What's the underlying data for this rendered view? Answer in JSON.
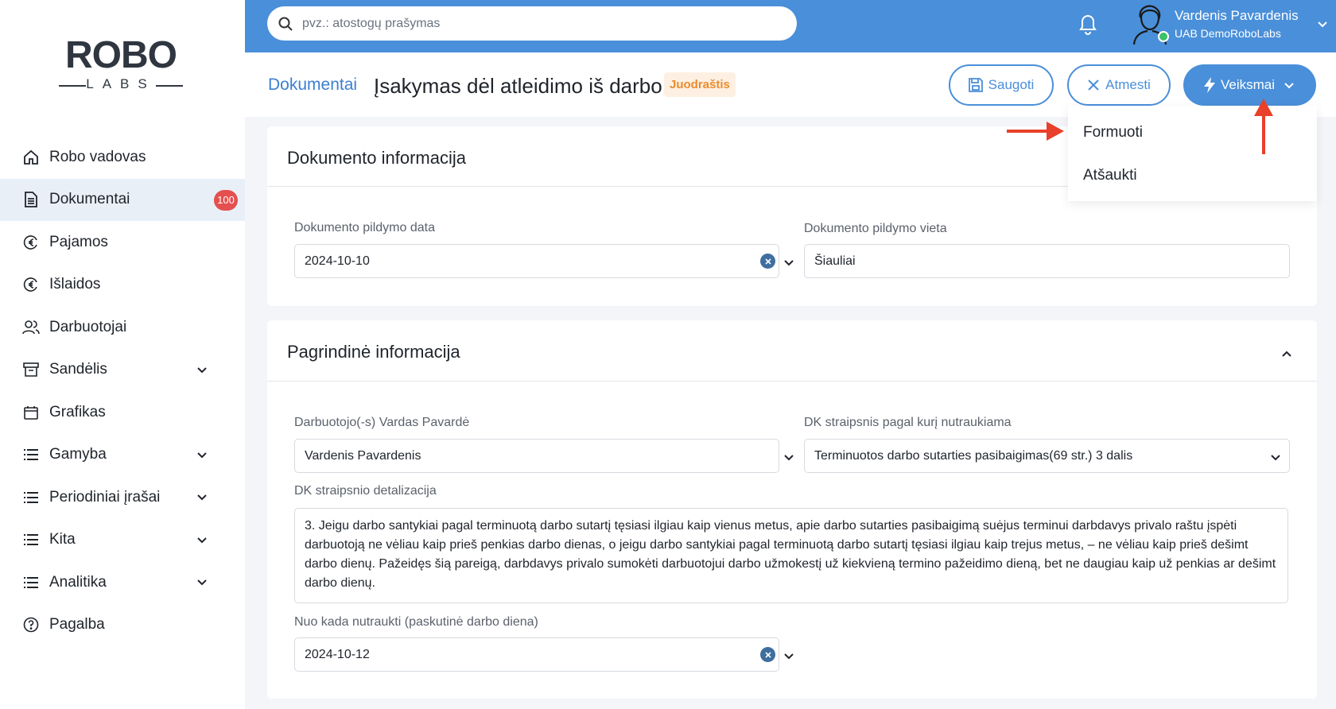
{
  "brand": {
    "logo_main": "ROBO",
    "logo_sub": "LABS"
  },
  "sidebar": {
    "items": [
      {
        "label": "Robo vadovas",
        "icon": "home-icon"
      },
      {
        "label": "Dokumentai",
        "icon": "document-icon",
        "badge": "100",
        "active": true
      },
      {
        "label": "Pajamos",
        "icon": "euro-in-icon"
      },
      {
        "label": "Išlaidos",
        "icon": "euro-out-icon"
      },
      {
        "label": "Darbuotojai",
        "icon": "users-icon"
      },
      {
        "label": "Sandėlis",
        "icon": "archive-icon",
        "expandable": true
      },
      {
        "label": "Grafikas",
        "icon": "calendar-icon"
      },
      {
        "label": "Gamyba",
        "icon": "list-icon",
        "expandable": true
      },
      {
        "label": "Periodiniai įrašai",
        "icon": "list-icon",
        "expandable": true
      },
      {
        "label": "Kita",
        "icon": "list-icon",
        "expandable": true
      },
      {
        "label": "Analitika",
        "icon": "list-icon",
        "expandable": true
      },
      {
        "label": "Pagalba",
        "icon": "help-icon"
      }
    ]
  },
  "topbar": {
    "search_placeholder": "pvz.: atostogų prašymas",
    "user_name": "Vardenis Pavardenis",
    "user_company": "UAB DemoRoboLabs",
    "accent_color": "#4a8fd9"
  },
  "header": {
    "breadcrumb": "Dokumentai",
    "title": "Įsakymas dėl atleidimo iš darbo",
    "status": "Juodraštis",
    "save_label": "Saugoti",
    "reject_label": "Atmesti",
    "actions_label": "Veiksmai"
  },
  "actions_menu": {
    "items": [
      "Formuoti",
      "Atšaukti"
    ]
  },
  "doc_info": {
    "title": "Dokumento informacija",
    "date_label": "Dokumento pildymo data",
    "date_value": "2024-10-10",
    "place_label": "Dokumento pildymo vieta",
    "place_value": "Šiauliai"
  },
  "main_info": {
    "title": "Pagrindinė informacija",
    "employee_label": "Darbuotojo(-s) Vardas Pavardė",
    "employee_value": "Vardenis Pavardenis",
    "article_label": "DK straipsnis pagal kurį nutraukiama",
    "article_value": "Terminuotos darbo sutarties pasibaigimas(69 str.) 3 dalis",
    "detail_label": "DK straipsnio detalizacija",
    "detail_value": "3. Jeigu darbo santykiai pagal terminuotą darbo sutartį tęsiasi ilgiau kaip vienus metus, apie darbo sutarties pasibaigimą suėjus terminui darbdavys privalo raštu įspėti darbuotoją ne vėliau kaip prieš penkias darbo dienas, o jeigu darbo santykiai pagal terminuotą darbo sutartį tęsiasi ilgiau kaip trejus metus, – ne vėliau kaip prieš dešimt darbo dienų. Pažeidęs šią pareigą, darbdavys privalo sumokėti darbuotojui darbo užmokestį už kiekvieną termino pažeidimo dieną, bet ne daugiau kaip už penkias ar dešimt darbo dienų.",
    "end_label": "Nuo kada nutraukti (paskutinė darbo diena)",
    "end_value": "2024-10-12"
  }
}
